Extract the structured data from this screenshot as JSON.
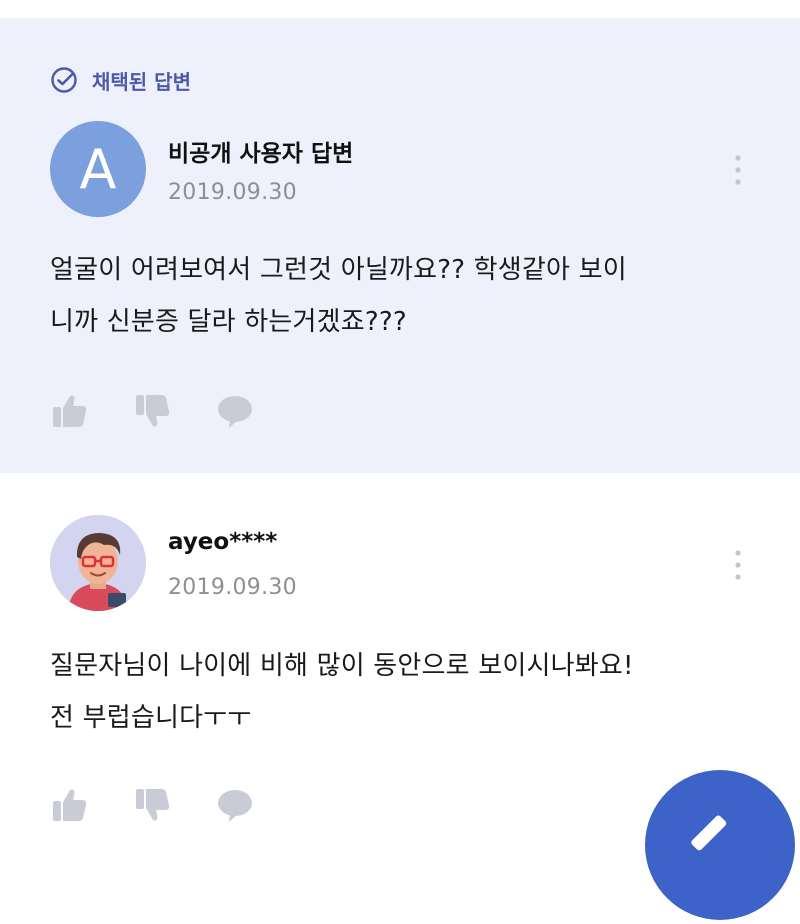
{
  "accepted_badge": {
    "label": "채택된 답변",
    "icon": "check-circle-icon",
    "color": "#4a5aa8"
  },
  "answers": [
    {
      "avatar_letter": "A",
      "author": "비공개 사용자 답변",
      "date": "2019.09.30",
      "body_lines": [
        "얼굴이 어려보여서 그런것 아닐까요?? 학생같아 보이",
        "니까 신분증 달라 하는거겠죠???"
      ],
      "background": "#eef0fb"
    },
    {
      "avatar_icon": "user-avatar-icon",
      "author": "ayeo****",
      "date": "2019.09.30",
      "body_lines": [
        "질문자님이 나이에 비해 많이 동안으로 보이시나봐요!",
        "전 부럽습니다ㅜㅜ"
      ],
      "background": "#ffffff"
    }
  ],
  "actions": {
    "like_icon": "thumbs-up-icon",
    "dislike_icon": "thumbs-down-icon",
    "comment_icon": "comment-icon",
    "color": "#c9ccd6"
  },
  "more_icon": "more-vertical-icon",
  "fab": {
    "icon": "pencil-icon",
    "color": "#3d63c9"
  }
}
